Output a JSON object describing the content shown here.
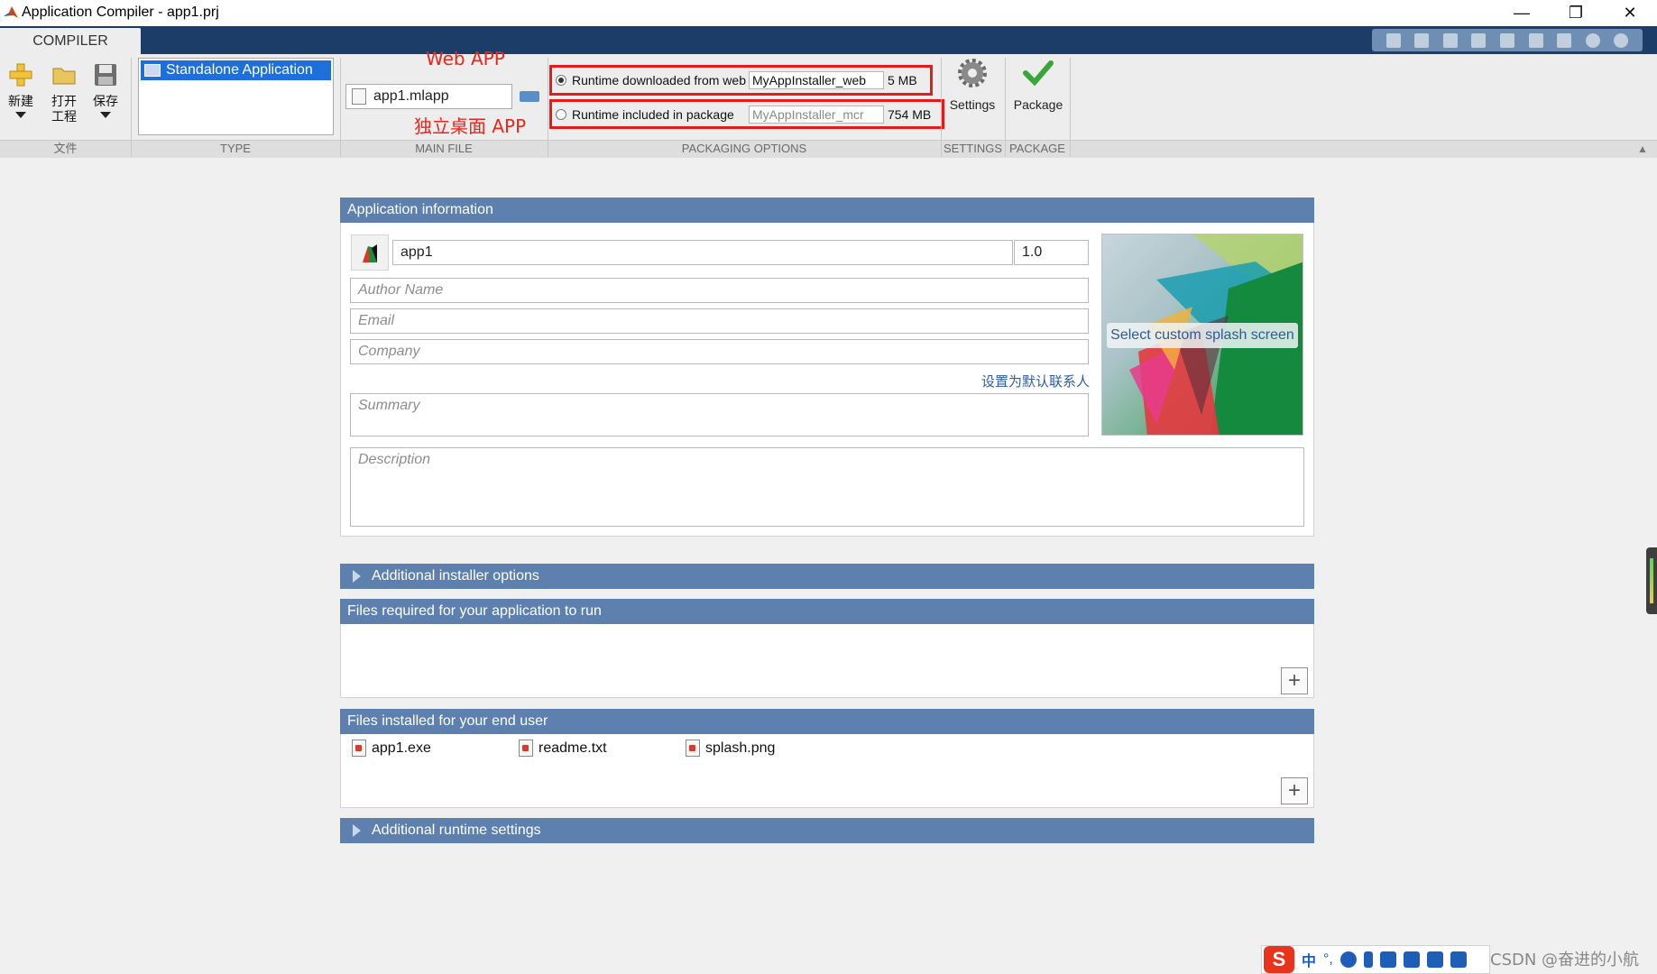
{
  "window": {
    "title": "Application Compiler - app1.prj",
    "controls": [
      "minimize",
      "restore",
      "close"
    ]
  },
  "tabs": {
    "active": "COMPILER"
  },
  "quick_access": {
    "icons": [
      "save-icon",
      "cut-icon",
      "copy-icon",
      "paste-icon",
      "undo-icon",
      "redo-icon",
      "switch-windows-icon",
      "help-icon",
      "options-icon"
    ]
  },
  "ribbon": {
    "file_group": {
      "label": "文件",
      "new": "新建",
      "open_line1": "打开",
      "open_line2": "工程",
      "save": "保存"
    },
    "type_group": {
      "label": "TYPE",
      "selected": "Standalone Application"
    },
    "main_file_group": {
      "label": "MAIN FILE",
      "file": "app1.mlapp"
    },
    "packaging_group": {
      "label": "PACKAGING OPTIONS",
      "options": [
        {
          "label": "Runtime downloaded from web",
          "installer": "MyAppInstaller_web",
          "size": "5 MB",
          "selected": true
        },
        {
          "label": "Runtime included in package",
          "installer": "MyAppInstaller_mcr",
          "size": "754 MB",
          "selected": false
        }
      ]
    },
    "settings_group": {
      "label": "SETTINGS",
      "button": "Settings"
    },
    "package_group": {
      "label": "PACKAGE",
      "button": "Package"
    }
  },
  "annotations": {
    "web_app": "Web APP",
    "desktop_app": "独立桌面 APP"
  },
  "app_info": {
    "header": "Application information",
    "name": "app1",
    "version": "1.0",
    "author_placeholder": "Author Name",
    "email_placeholder": "Email",
    "company_placeholder": "Company",
    "set_default_contact": "设置为默认联系人",
    "summary_placeholder": "Summary",
    "description_placeholder": "Description",
    "splash_label": "Select custom splash screen"
  },
  "sections": {
    "installer_options": "Additional installer options",
    "files_required": "Files required for your application to run",
    "files_installed": "Files installed for your end user",
    "runtime_settings": "Additional runtime settings"
  },
  "installed_files": [
    "app1.exe",
    "readme.txt",
    "splash.png"
  ],
  "taskbar": {
    "ime_logo": "S",
    "ime_lang": "中",
    "ime_punct": "°,",
    "watermark": "CSDN @奋进的小航"
  },
  "colors": {
    "accent": "#5d80ae",
    "tab_strip": "#1c3d68",
    "annotation": "#e61a1a"
  }
}
